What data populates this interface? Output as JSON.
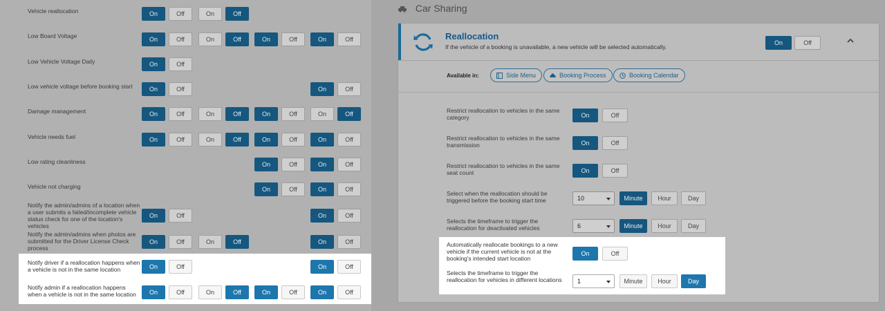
{
  "left": {
    "rows": [
      {
        "label": "Vehicle reallocation",
        "groups": [
          [
            "On",
            "Off",
            1
          ],
          [
            "On",
            "Off",
            2
          ]
        ]
      },
      {
        "label": "Low Board Voltage",
        "groups": [
          [
            "On",
            "Off",
            1
          ],
          [
            "On",
            "Off",
            2
          ],
          [
            "On",
            "Off",
            1
          ],
          [
            "On",
            "Off",
            1
          ]
        ]
      },
      {
        "label": "Low Vehicle Voltage Daily",
        "groups": [
          [
            "On",
            "Off",
            1
          ]
        ]
      },
      {
        "label": "Low vehicle voltage before booking start",
        "groups": [
          [
            "On",
            "Off",
            1
          ],
          null,
          null,
          [
            "On",
            "Off",
            1
          ]
        ]
      },
      {
        "label": "Damage management",
        "groups": [
          [
            "On",
            "Off",
            1
          ],
          [
            "On",
            "Off",
            2
          ],
          [
            "On",
            "Off",
            1
          ],
          [
            "On",
            "Off",
            2
          ]
        ]
      },
      {
        "label": "Vehicle needs fuel",
        "groups": [
          [
            "On",
            "Off",
            1
          ],
          [
            "On",
            "Off",
            2
          ],
          [
            "On",
            "Off",
            1
          ],
          [
            "On",
            "Off",
            1
          ]
        ]
      },
      {
        "label": "Low rating cleanliness",
        "groups": [
          null,
          null,
          [
            "On",
            "Off",
            1
          ],
          [
            "On",
            "Off",
            1
          ]
        ]
      },
      {
        "label": "Vehicle not charging",
        "groups": [
          null,
          null,
          [
            "On",
            "Off",
            1
          ],
          [
            "On",
            "Off",
            1
          ]
        ]
      },
      {
        "label": "Notify the admin/admins of a location when a user submits a failed/incomplete vehicle status check for one of the location's vehicles",
        "groups": [
          [
            "On",
            "Off",
            1
          ],
          null,
          null,
          [
            "On",
            "Off",
            1
          ]
        ]
      },
      {
        "label": "Notify the admin/admins when photos are submitted for the Driver License Check process",
        "groups": [
          [
            "On",
            "Off",
            1
          ],
          [
            "On",
            "Off",
            2
          ],
          null,
          [
            "On",
            "Off",
            1
          ]
        ]
      },
      {
        "label": "Notify driver if a reallocation happens when a vehicle is not in the same location",
        "groups": [
          [
            "On",
            "Off",
            1
          ],
          null,
          null,
          [
            "On",
            "Off",
            1
          ]
        ]
      },
      {
        "label": "Notify admin if a reallocation happens when a vehicle is not in the same location",
        "groups": [
          [
            "On",
            "Off",
            1
          ],
          [
            "On",
            "Off",
            2
          ],
          [
            "On",
            "Off",
            1
          ],
          [
            "On",
            "Off",
            1
          ]
        ]
      }
    ]
  },
  "right": {
    "section_title": "Car Sharing",
    "card": {
      "title": "Reallocation",
      "subtitle": "If the vehicle of a booking is unavailable, a new vehicle will be selected automatically.",
      "toggle_on": "On",
      "toggle_off": "Off",
      "available_label": "Available in:",
      "available": [
        "Side Menu",
        "Booking Process",
        "Booking Calendar"
      ]
    },
    "settings": [
      {
        "label": "Restrict reallocation to vehicles in the same category",
        "type": "toggle",
        "on": "On",
        "off": "Off",
        "state": 1
      },
      {
        "label": "Restrict reallocation to vehicles in the same transmission",
        "type": "toggle",
        "on": "On",
        "off": "Off",
        "state": 1
      },
      {
        "label": "Restrict reallocation to vehicles in the same seat count",
        "type": "toggle",
        "on": "On",
        "off": "Off",
        "state": 1
      },
      {
        "label": "Select when the reallocation should be triggered before the booking start time",
        "type": "time",
        "value": "10",
        "units": [
          "Minute",
          "Hour",
          "Day"
        ],
        "active": 0
      },
      {
        "label": "Selects the timeframe to trigger the reallocation for deactivated vehicles",
        "type": "time",
        "value": "6",
        "units": [
          "Minute",
          "Hour",
          "Day"
        ],
        "active": 0
      },
      {
        "label": "Automatically reallocate bookings to a new vehicle if the current vehicle is not at the booking's intended start location",
        "type": "toggle",
        "on": "On",
        "off": "Off",
        "state": 1
      },
      {
        "label": "Selects the timeframe to trigger the reallocation for vehicles in different locations",
        "type": "time",
        "value": "1",
        "units": [
          "Minute",
          "Hour",
          "Day"
        ],
        "active": 2
      }
    ]
  }
}
